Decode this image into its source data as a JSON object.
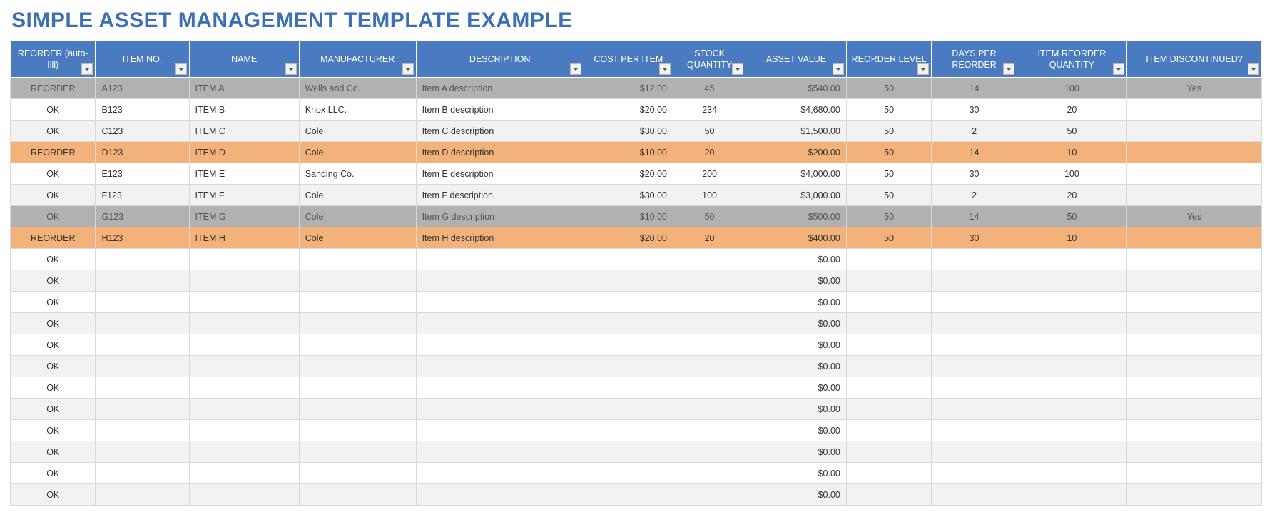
{
  "title": "SIMPLE ASSET MANAGEMENT TEMPLATE EXAMPLE",
  "columns": [
    {
      "key": "reorder",
      "label": "REORDER (auto-fill)"
    },
    {
      "key": "item_no",
      "label": "ITEM NO."
    },
    {
      "key": "name",
      "label": "NAME"
    },
    {
      "key": "manufacturer",
      "label": "MANUFACTURER"
    },
    {
      "key": "description",
      "label": "DESCRIPTION"
    },
    {
      "key": "cost",
      "label": "COST PER ITEM"
    },
    {
      "key": "stock",
      "label": "STOCK QUANTITY"
    },
    {
      "key": "asset",
      "label": "ASSET VALUE"
    },
    {
      "key": "level",
      "label": "REORDER LEVEL"
    },
    {
      "key": "days",
      "label": "DAYS PER REORDER"
    },
    {
      "key": "reqty",
      "label": "ITEM REORDER QUANTITY"
    },
    {
      "key": "disc",
      "label": "ITEM DISCONTINUED?"
    }
  ],
  "rows": [
    {
      "style": "grey",
      "reorder": "REORDER",
      "item_no": "A123",
      "name": "ITEM A",
      "manufacturer": "Wells and Co.",
      "description": "Item A description",
      "cost": "$12.00",
      "stock": "45",
      "asset": "$540.00",
      "level": "50",
      "days": "14",
      "reqty": "100",
      "disc": "Yes"
    },
    {
      "style": "white",
      "reorder": "OK",
      "item_no": "B123",
      "name": "ITEM B",
      "manufacturer": "Knox LLC.",
      "description": "Item B description",
      "cost": "$20.00",
      "stock": "234",
      "asset": "$4,680.00",
      "level": "50",
      "days": "30",
      "reqty": "20",
      "disc": ""
    },
    {
      "style": "band",
      "reorder": "OK",
      "item_no": "C123",
      "name": "ITEM C",
      "manufacturer": "Cole",
      "description": "Item C description",
      "cost": "$30.00",
      "stock": "50",
      "asset": "$1,500.00",
      "level": "50",
      "days": "2",
      "reqty": "50",
      "disc": ""
    },
    {
      "style": "orange",
      "reorder": "REORDER",
      "item_no": "D123",
      "name": "ITEM D",
      "manufacturer": "Cole",
      "description": "Item D description",
      "cost": "$10.00",
      "stock": "20",
      "asset": "$200.00",
      "level": "50",
      "days": "14",
      "reqty": "10",
      "disc": ""
    },
    {
      "style": "white",
      "reorder": "OK",
      "item_no": "E123",
      "name": "ITEM E",
      "manufacturer": "Sanding Co.",
      "description": "Item E description",
      "cost": "$20.00",
      "stock": "200",
      "asset": "$4,000.00",
      "level": "50",
      "days": "30",
      "reqty": "100",
      "disc": ""
    },
    {
      "style": "band",
      "reorder": "OK",
      "item_no": "F123",
      "name": "ITEM F",
      "manufacturer": "Cole",
      "description": "Item F description",
      "cost": "$30.00",
      "stock": "100",
      "asset": "$3,000.00",
      "level": "50",
      "days": "2",
      "reqty": "20",
      "disc": ""
    },
    {
      "style": "grey",
      "reorder": "OK",
      "item_no": "G123",
      "name": "ITEM G",
      "manufacturer": "Cole",
      "description": "Item G description",
      "cost": "$10.00",
      "stock": "50",
      "asset": "$500.00",
      "level": "50",
      "days": "14",
      "reqty": "50",
      "disc": "Yes"
    },
    {
      "style": "orange",
      "reorder": "REORDER",
      "item_no": "H123",
      "name": "ITEM H",
      "manufacturer": "Cole",
      "description": "Item H description",
      "cost": "$20.00",
      "stock": "20",
      "asset": "$400.00",
      "level": "50",
      "days": "30",
      "reqty": "10",
      "disc": ""
    },
    {
      "style": "white",
      "reorder": "OK",
      "item_no": "",
      "name": "",
      "manufacturer": "",
      "description": "",
      "cost": "",
      "stock": "",
      "asset": "$0.00",
      "level": "",
      "days": "",
      "reqty": "",
      "disc": ""
    },
    {
      "style": "band",
      "reorder": "OK",
      "item_no": "",
      "name": "",
      "manufacturer": "",
      "description": "",
      "cost": "",
      "stock": "",
      "asset": "$0.00",
      "level": "",
      "days": "",
      "reqty": "",
      "disc": ""
    },
    {
      "style": "white",
      "reorder": "OK",
      "item_no": "",
      "name": "",
      "manufacturer": "",
      "description": "",
      "cost": "",
      "stock": "",
      "asset": "$0.00",
      "level": "",
      "days": "",
      "reqty": "",
      "disc": ""
    },
    {
      "style": "band",
      "reorder": "OK",
      "item_no": "",
      "name": "",
      "manufacturer": "",
      "description": "",
      "cost": "",
      "stock": "",
      "asset": "$0.00",
      "level": "",
      "days": "",
      "reqty": "",
      "disc": ""
    },
    {
      "style": "white",
      "reorder": "OK",
      "item_no": "",
      "name": "",
      "manufacturer": "",
      "description": "",
      "cost": "",
      "stock": "",
      "asset": "$0.00",
      "level": "",
      "days": "",
      "reqty": "",
      "disc": ""
    },
    {
      "style": "band",
      "reorder": "OK",
      "item_no": "",
      "name": "",
      "manufacturer": "",
      "description": "",
      "cost": "",
      "stock": "",
      "asset": "$0.00",
      "level": "",
      "days": "",
      "reqty": "",
      "disc": ""
    },
    {
      "style": "white",
      "reorder": "OK",
      "item_no": "",
      "name": "",
      "manufacturer": "",
      "description": "",
      "cost": "",
      "stock": "",
      "asset": "$0.00",
      "level": "",
      "days": "",
      "reqty": "",
      "disc": ""
    },
    {
      "style": "band",
      "reorder": "OK",
      "item_no": "",
      "name": "",
      "manufacturer": "",
      "description": "",
      "cost": "",
      "stock": "",
      "asset": "$0.00",
      "level": "",
      "days": "",
      "reqty": "",
      "disc": ""
    },
    {
      "style": "white",
      "reorder": "OK",
      "item_no": "",
      "name": "",
      "manufacturer": "",
      "description": "",
      "cost": "",
      "stock": "",
      "asset": "$0.00",
      "level": "",
      "days": "",
      "reqty": "",
      "disc": ""
    },
    {
      "style": "band",
      "reorder": "OK",
      "item_no": "",
      "name": "",
      "manufacturer": "",
      "description": "",
      "cost": "",
      "stock": "",
      "asset": "$0.00",
      "level": "",
      "days": "",
      "reqty": "",
      "disc": ""
    },
    {
      "style": "white",
      "reorder": "OK",
      "item_no": "",
      "name": "",
      "manufacturer": "",
      "description": "",
      "cost": "",
      "stock": "",
      "asset": "$0.00",
      "level": "",
      "days": "",
      "reqty": "",
      "disc": ""
    },
    {
      "style": "band",
      "reorder": "OK",
      "item_no": "",
      "name": "",
      "manufacturer": "",
      "description": "",
      "cost": "",
      "stock": "",
      "asset": "$0.00",
      "level": "",
      "days": "",
      "reqty": "",
      "disc": ""
    }
  ]
}
